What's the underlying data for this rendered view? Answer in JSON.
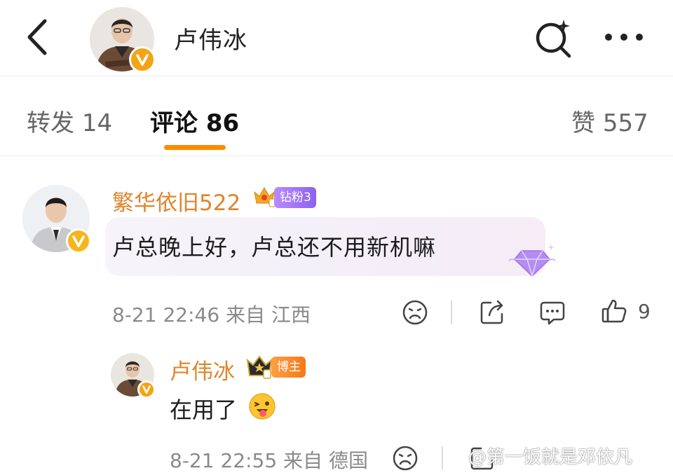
{
  "header": {
    "back_icon": "chevron-left-icon",
    "user_name": "卢伟冰",
    "search_icon": "search-sparkle-icon",
    "more_icon": "more-dots-icon"
  },
  "tabs": {
    "repost_label": "转发",
    "repost_count": "14",
    "comments_label": "评论",
    "comments_count": "86",
    "likes_label": "赞",
    "likes_count": "557",
    "active_underline_color": "#ff8a00"
  },
  "comment": {
    "user_name": "繁华依旧522",
    "fan_badge": "钻粉3",
    "text": "卢总晚上好，卢总还不用新机嘛",
    "time": "8-21 22:46",
    "from_label": "来自",
    "location": "江西",
    "like_count": "9",
    "name_color": "#e0852b"
  },
  "reply": {
    "user_name": "卢伟冰",
    "badge": "博主",
    "text": "在用了",
    "emoji": "winking-tongue-emoji",
    "time": "8-21 22:55",
    "from_label": "来自",
    "location": "德国"
  },
  "watermark": "@第一饭就是邓依凡"
}
